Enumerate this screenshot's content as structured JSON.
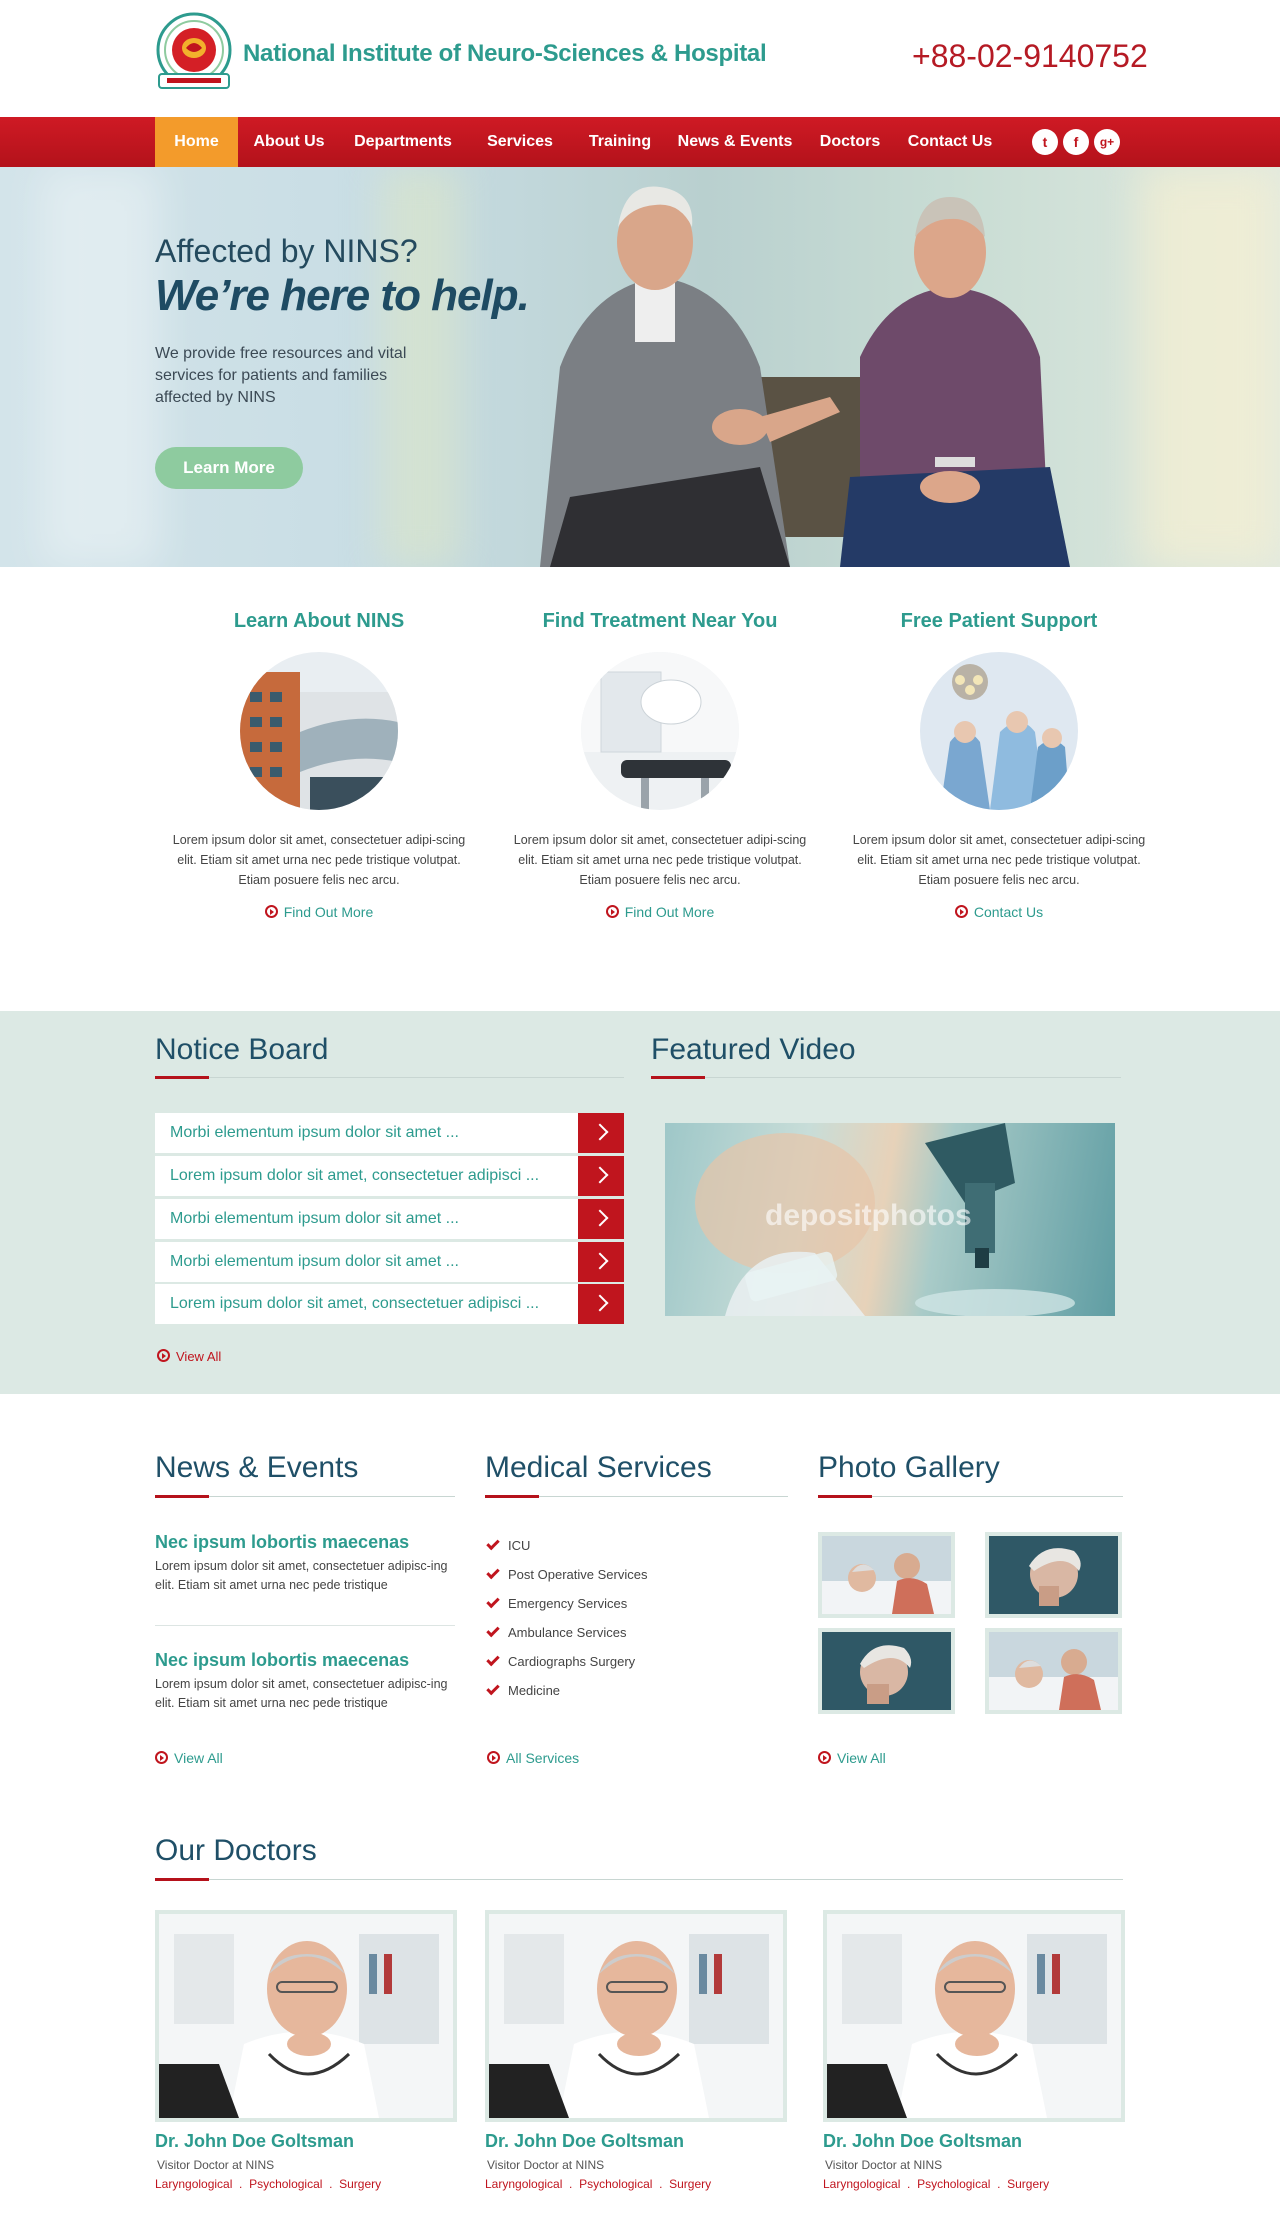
{
  "header": {
    "site_title": "National Institute of Neuro-Sciences & Hospital",
    "phone": "+88-02-9140752"
  },
  "nav": {
    "items": [
      "Home",
      "About Us",
      "Departments",
      "Services",
      "Training",
      "News & Events",
      "Doctors",
      "Contact Us"
    ],
    "active": "Home",
    "social": {
      "twitter": "t",
      "facebook": "f",
      "gplus": "g+"
    }
  },
  "hero": {
    "line1": "Affected by NINS?",
    "line2": "We’re here to help.",
    "text": "We provide free resources and vital services for patients and families affected by NINS",
    "button": "Learn More"
  },
  "features": [
    {
      "title": "Learn About NINS",
      "text": "Lorem ipsum dolor sit amet, consectetuer adipi-scing elit. Etiam sit amet urna nec pede tristique volutpat. Etiam posuere felis nec arcu.",
      "link": "Find Out More"
    },
    {
      "title": "Find Treatment Near You",
      "text": "Lorem ipsum dolor sit amet, consectetuer adipi-scing elit. Etiam sit amet urna nec pede tristique volutpat. Etiam posuere felis nec arcu.",
      "link": "Find Out More"
    },
    {
      "title": "Free Patient Support",
      "text": "Lorem ipsum dolor sit amet, consectetuer adipi-scing elit. Etiam sit amet urna nec pede tristique volutpat. Etiam posuere felis nec arcu.",
      "link": "Contact Us"
    }
  ],
  "notice_board": {
    "title": "Notice Board",
    "items": [
      "Morbi elementum ipsum dolor sit amet ...",
      "Lorem ipsum dolor sit amet, consectetuer adipisci ...",
      "Morbi elementum ipsum dolor sit amet ...",
      "Morbi elementum ipsum dolor sit amet ...",
      "Lorem ipsum dolor sit amet, consectetuer adipisci ..."
    ],
    "view_all": "View All"
  },
  "featured_video": {
    "title": "Featured Video",
    "watermark": "depositphotos"
  },
  "news_events": {
    "title": "News & Events",
    "items": [
      {
        "title": "Nec ipsum lobortis maecenas",
        "text": "Lorem ipsum dolor sit amet, consectetuer adipisc-ing elit. Etiam sit amet urna nec pede tristique"
      },
      {
        "title": "Nec ipsum lobortis maecenas",
        "text": "Lorem ipsum dolor sit amet, consectetuer adipisc-ing elit. Etiam sit amet urna nec pede tristique"
      }
    ],
    "view_all": "View All"
  },
  "medical_services": {
    "title": "Medical Services",
    "items": [
      "ICU",
      "Post Operative Services",
      "Emergency Services",
      "Ambulance Services",
      "Cardiographs Surgery",
      "Medicine"
    ],
    "all": "All Services"
  },
  "photo_gallery": {
    "title": "Photo Gallery",
    "view_all": "View All"
  },
  "doctors": {
    "title": "Our Doctors",
    "items": [
      {
        "name": "Dr. John Doe Goltsman",
        "role": "Visitor Doctor at NINS",
        "tags": [
          "Laryngological",
          "Psychological",
          "Surgery"
        ]
      },
      {
        "name": "Dr. John Doe Goltsman",
        "role": "Visitor Doctor at NINS",
        "tags": [
          "Laryngological",
          "Psychological",
          "Surgery"
        ]
      },
      {
        "name": "Dr. John Doe Goltsman",
        "role": "Visitor Doctor at NINS",
        "tags": [
          "Laryngological",
          "Psychological",
          "Surgery"
        ]
      }
    ]
  },
  "colors": {
    "brand_red": "#c0151e",
    "teal": "#2d9b8e",
    "orange": "#f39b2b",
    "navy": "#1f4f67",
    "band": "#dce9e4"
  }
}
